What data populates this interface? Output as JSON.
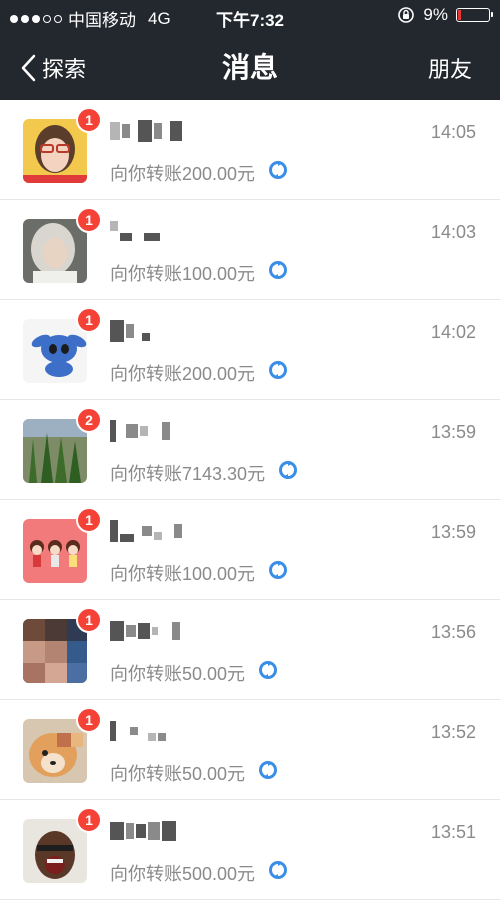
{
  "status_bar": {
    "carrier": "中国移动",
    "network": "4G",
    "time": "下午7:32",
    "battery": "9%",
    "battery_level": 0.09,
    "battery_color": "#e53935"
  },
  "nav": {
    "back_label": "探索",
    "title": "消息",
    "right_label": "朋友"
  },
  "theme": {
    "header_bg": "#23272e",
    "badge_color": "#f44336",
    "refresh_icon_color": "#3b8ee6"
  },
  "messages": [
    {
      "badge": "1",
      "time": "14:05",
      "text": "向你转账200.00元",
      "avatar_icon": "avatar-girl-glasses"
    },
    {
      "badge": "1",
      "time": "14:03",
      "text": "向你转账100.00元",
      "avatar_icon": "avatar-silver-hair"
    },
    {
      "badge": "1",
      "time": "14:02",
      "text": "向你转账200.00元",
      "avatar_icon": "avatar-stitch"
    },
    {
      "badge": "2",
      "time": "13:59",
      "text": "向你转账7143.30元",
      "avatar_icon": "avatar-plants"
    },
    {
      "badge": "1",
      "time": "13:59",
      "text": "向你转账100.00元",
      "avatar_icon": "avatar-cartoon-girls"
    },
    {
      "badge": "1",
      "time": "13:56",
      "text": "向你转账50.00元",
      "avatar_icon": "avatar-pixelated-face"
    },
    {
      "badge": "1",
      "time": "13:52",
      "text": "向你转账50.00元",
      "avatar_icon": "avatar-puppy"
    },
    {
      "badge": "1",
      "time": "13:51",
      "text": "向你转账500.00元",
      "avatar_icon": "avatar-shouting-man"
    }
  ]
}
